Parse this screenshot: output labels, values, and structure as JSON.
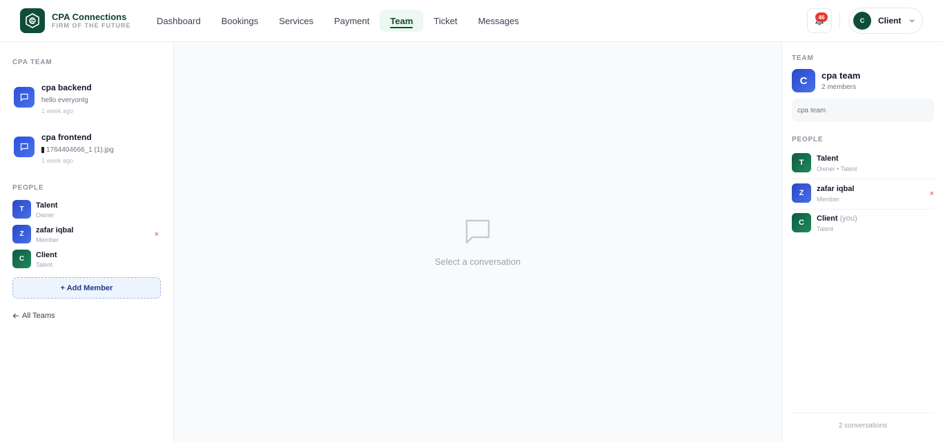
{
  "brand": {
    "name": "CPA Connections",
    "tagline": "FIRM OF THE FUTURE",
    "logo_color": "#0f4d3a"
  },
  "nav": {
    "items": [
      {
        "label": "Dashboard",
        "active": false
      },
      {
        "label": "Bookings",
        "active": false
      },
      {
        "label": "Services",
        "active": false
      },
      {
        "label": "Payment",
        "active": false
      },
      {
        "label": "Team",
        "active": true
      },
      {
        "label": "Ticket",
        "active": false
      },
      {
        "label": "Messages",
        "active": false
      }
    ]
  },
  "header": {
    "notification_count": "46",
    "notification_icon": "bell-icon",
    "user": {
      "initial": "C",
      "name": "Client"
    }
  },
  "left": {
    "team_label": "CPA TEAM",
    "conversations": [
      {
        "title": "cpa backend",
        "preview": "hello everyontg",
        "time": "1 week ago"
      },
      {
        "title": "cpa frontend",
        "preview": "1764404666_1 (1).jpg",
        "time": "1 week ago"
      }
    ],
    "people_label": "PEOPLE",
    "people": [
      {
        "initial": "T",
        "name": "Talent",
        "role": "Owner"
      },
      {
        "initial": "Z",
        "name": "zafar iqbal",
        "role": "Member",
        "remove": "×"
      },
      {
        "initial": "C",
        "name": "Client",
        "role": "Talent"
      }
    ],
    "add_member_label": "+ Add Member",
    "all_teams_label": "All Teams"
  },
  "center": {
    "empty_text": "Select a conversation",
    "empty_icon": "chat-bubble-icon"
  },
  "right": {
    "team_label": "TEAM",
    "team_initial": "C",
    "team_name": "cpa team",
    "team_members": "2 members",
    "team_description": "cpa team",
    "people_label": "PEOPLE",
    "people": [
      {
        "initial": "T",
        "name": "Talent",
        "you": "",
        "role": "Owner • Talent"
      },
      {
        "initial": "Z",
        "name": "zafar iqbal",
        "you": "",
        "role": "Member",
        "remove": "×"
      },
      {
        "initial": "C",
        "name": "Client",
        "you": "(you)",
        "role": "Talent"
      }
    ],
    "footer": "2 conversations"
  },
  "colors": {
    "accent_green": "#0f4d3a",
    "accent_blue": "#2b50d8",
    "danger": "#e53935"
  }
}
